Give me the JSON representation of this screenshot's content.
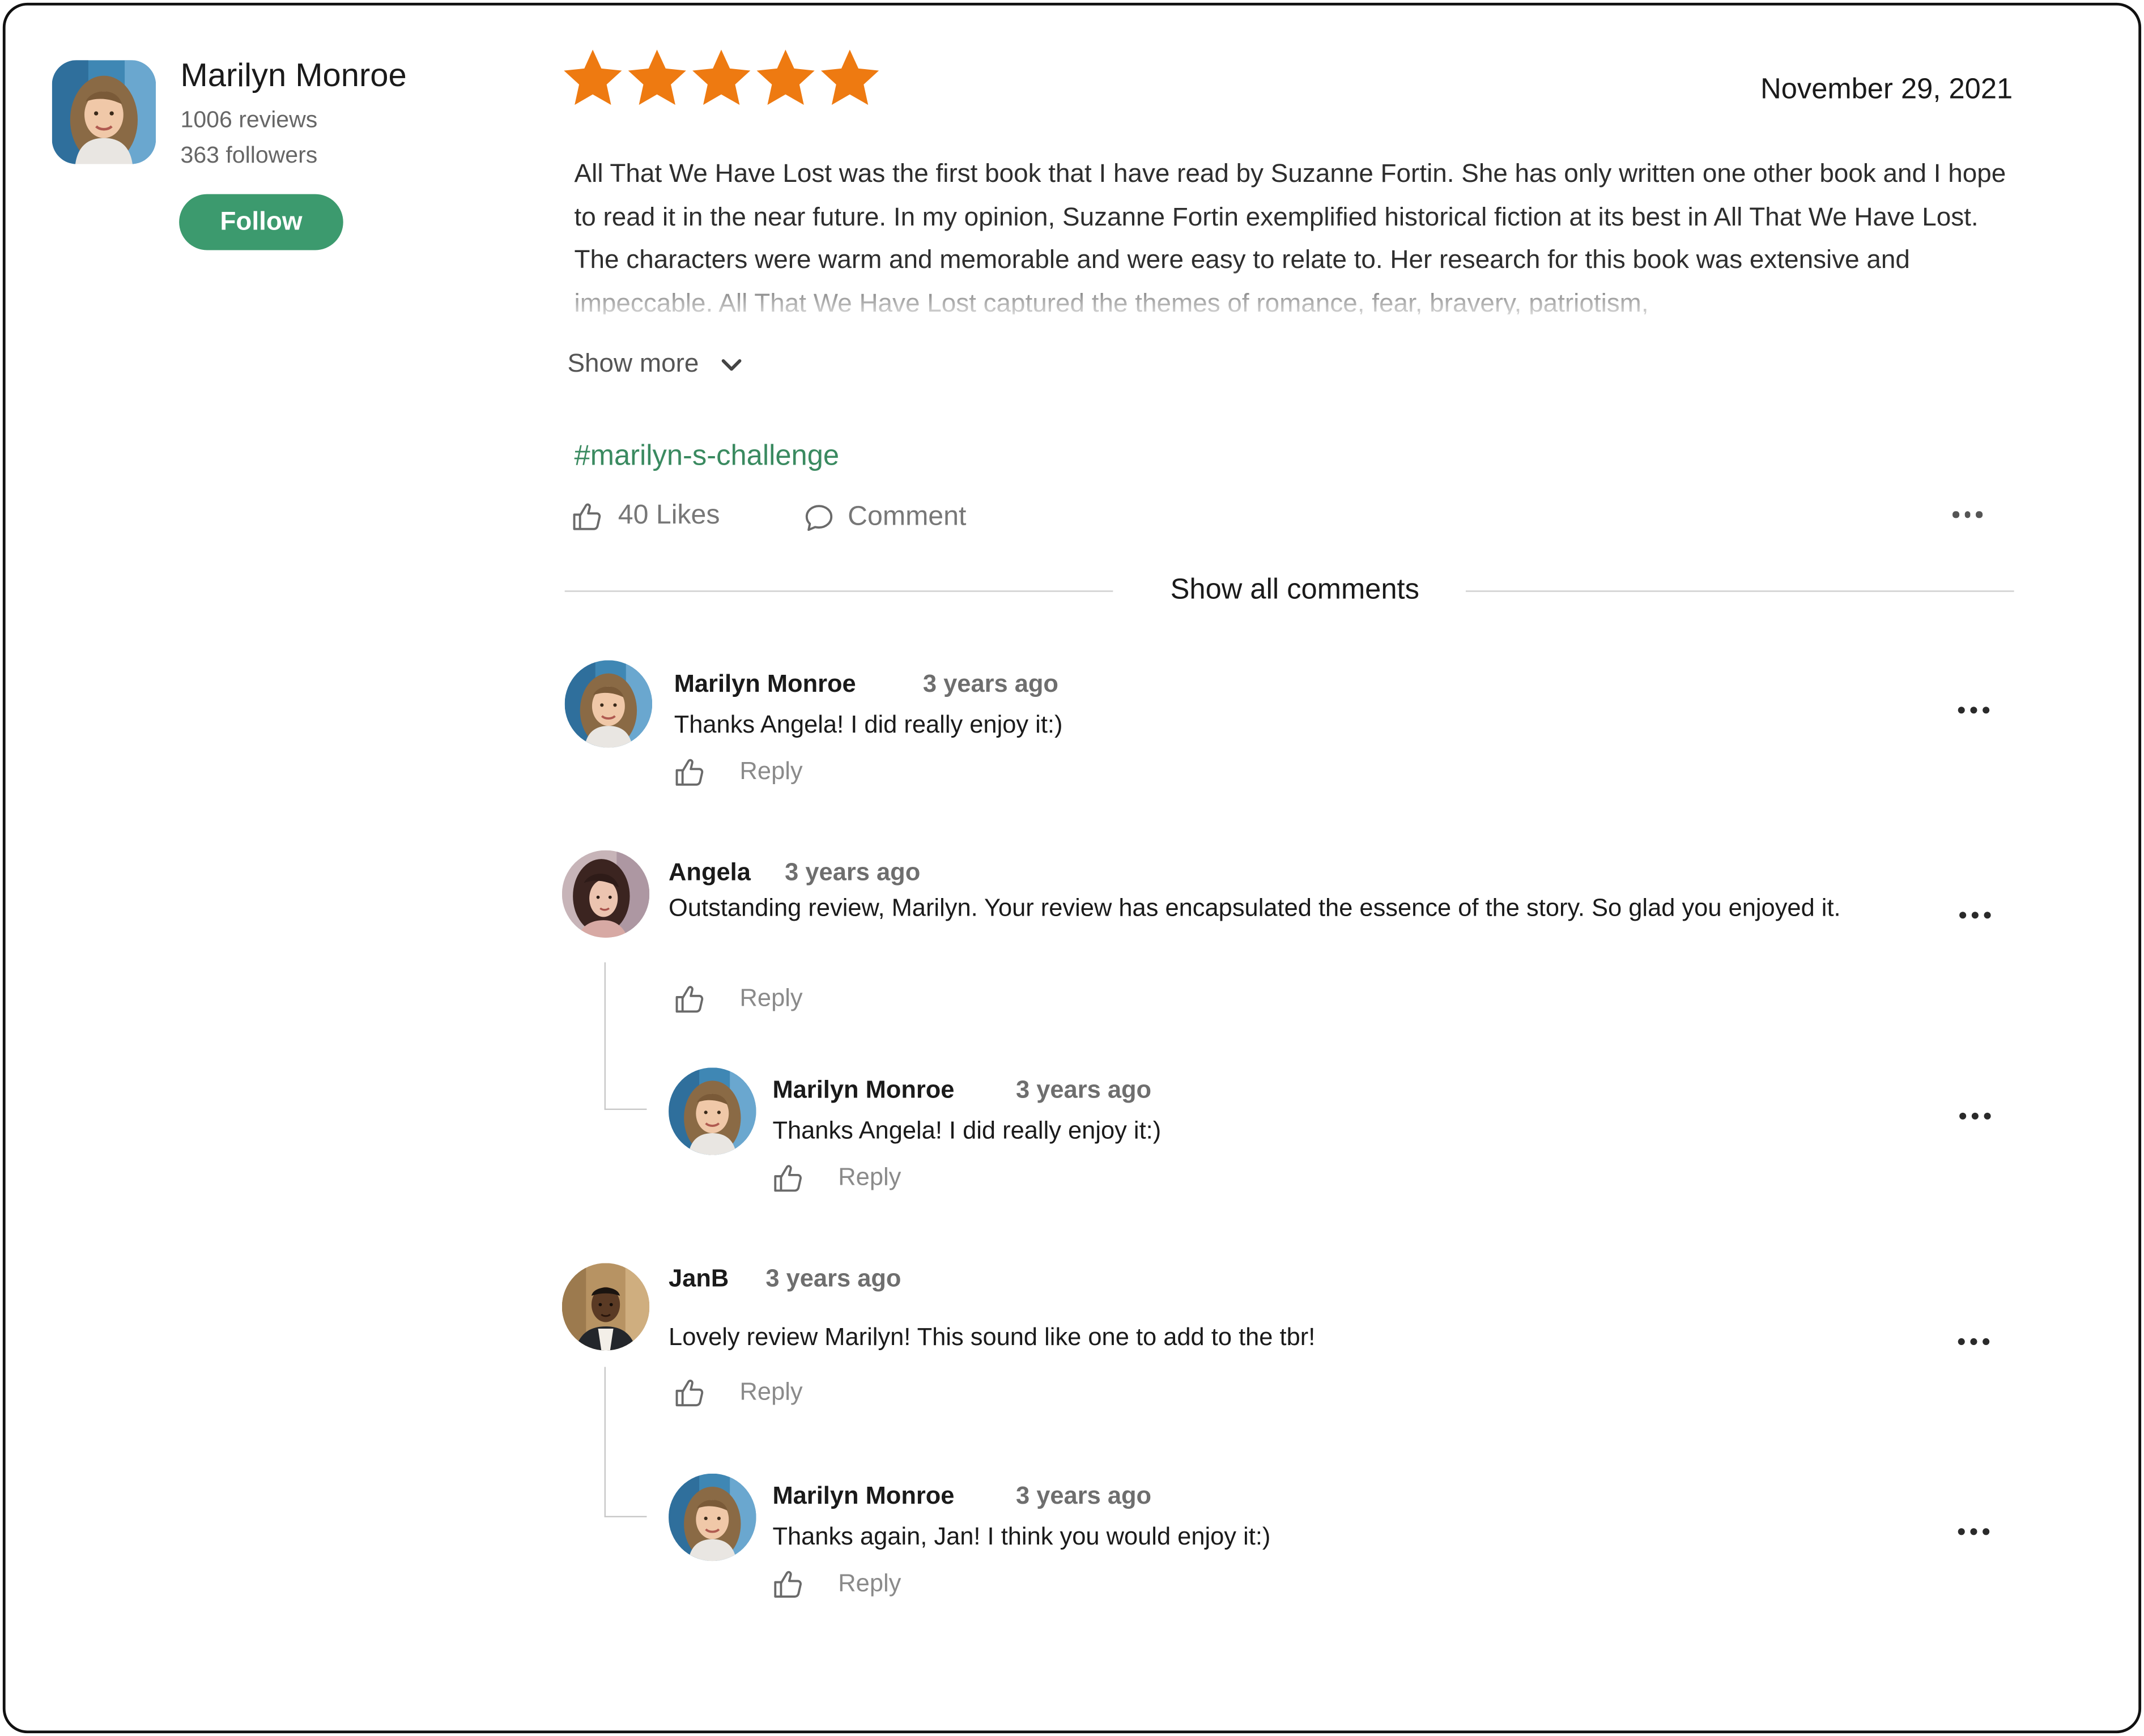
{
  "reviewer": {
    "name": "Marilyn Monroe",
    "reviews": "1006 reviews",
    "followers": "363 followers",
    "follow_label": "Follow"
  },
  "review": {
    "rating": 5,
    "rating_max": 5,
    "date": "November 29, 2021",
    "body": "All That We Have Lost was the first book that I have read by Suzanne Fortin. She has only written one other book and I hope to read it in the near future. In my opinion, Suzanne Fortin exemplified historical fiction at its best in All That We Have Lost. The characters were warm and memorable and were easy to relate to. Her research for this book was extensive and impeccable. All That We Have Lost captured the themes of romance, fear, bravery, patriotism,",
    "show_more_label": "Show more",
    "hashtag": "#marilyn-s-challenge",
    "likes_label": "40 Likes",
    "comment_label": "Comment"
  },
  "comments_section": {
    "show_all_label": "Show all comments"
  },
  "comments": [
    {
      "author": "Marilyn Monroe",
      "time": "3 years ago",
      "text": "Thanks Angela! I did really enjoy it:)",
      "reply_label": "Reply"
    },
    {
      "author": "Angela",
      "time": "3 years ago",
      "text": "Outstanding review, Marilyn. Your review has encapsulated the essence of the story. So glad you enjoyed it.",
      "reply_label": "Reply",
      "replies": [
        {
          "author": "Marilyn Monroe",
          "time": "3 years ago",
          "text": "Thanks Angela! I did really enjoy it:)",
          "reply_label": "Reply"
        }
      ]
    },
    {
      "author": "JanB",
      "time": "3 years ago",
      "text": "Lovely review Marilyn! This sound like one to add to the tbr!",
      "reply_label": "Reply",
      "replies": [
        {
          "author": "Marilyn Monroe",
          "time": "3 years ago",
          "text": "Thanks again, Jan! I think you would enjoy it:)",
          "reply_label": "Reply"
        }
      ]
    }
  ],
  "icons": {
    "star": "star-icon",
    "chevron": "chevron-down-icon",
    "like": "thumbs-up-icon",
    "comment": "speech-bubble-icon",
    "more": "more-horizontal-icon"
  },
  "colors": {
    "star": "#ee7a11",
    "follow_button": "#3c9a6e",
    "hashtag": "#3a8a60"
  }
}
